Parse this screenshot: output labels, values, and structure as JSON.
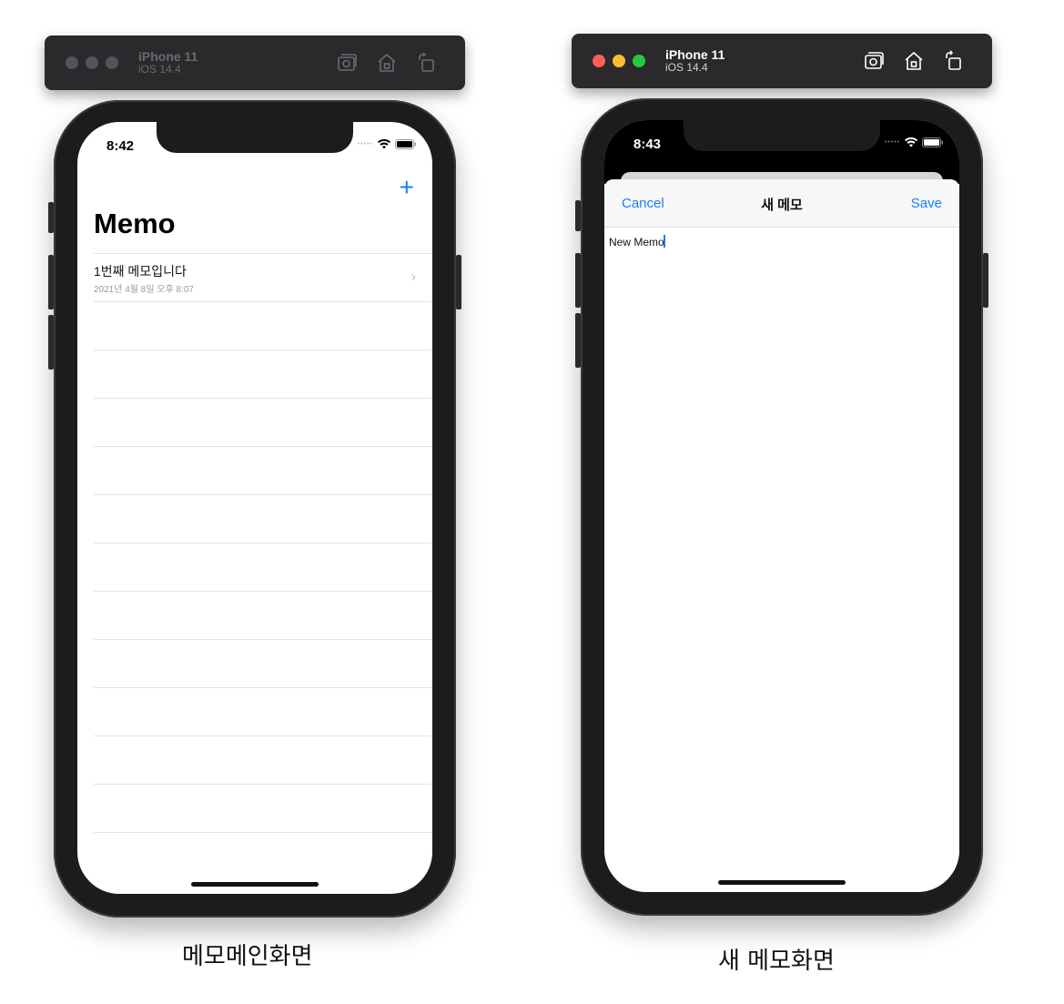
{
  "colors": {
    "accent": "#1a7dfc",
    "traffic_inactive": "#55535a",
    "traffic_red": "#ff5f57",
    "traffic_yellow": "#febc2e",
    "traffic_green": "#28c840",
    "titlebar_text_inactive": "#6b6a70",
    "titlebar_text_active": "#ffffff"
  },
  "left": {
    "simulator": {
      "device": "iPhone 11",
      "os": "iOS 14.4"
    },
    "status": {
      "time": "8:42"
    },
    "nav": {
      "add_icon": "+"
    },
    "title": "Memo",
    "memos": [
      {
        "title": "1번째 메모입니다",
        "date": "2021년 4월 8일 오후 8:07"
      }
    ],
    "caption": "메모메인화면"
  },
  "right": {
    "simulator": {
      "device": "iPhone 11",
      "os": "iOS 14.4"
    },
    "status": {
      "time": "8:43"
    },
    "nav": {
      "cancel": "Cancel",
      "title": "새 메모",
      "save": "Save"
    },
    "text": "New Memo",
    "caption": "새 메모화면"
  }
}
